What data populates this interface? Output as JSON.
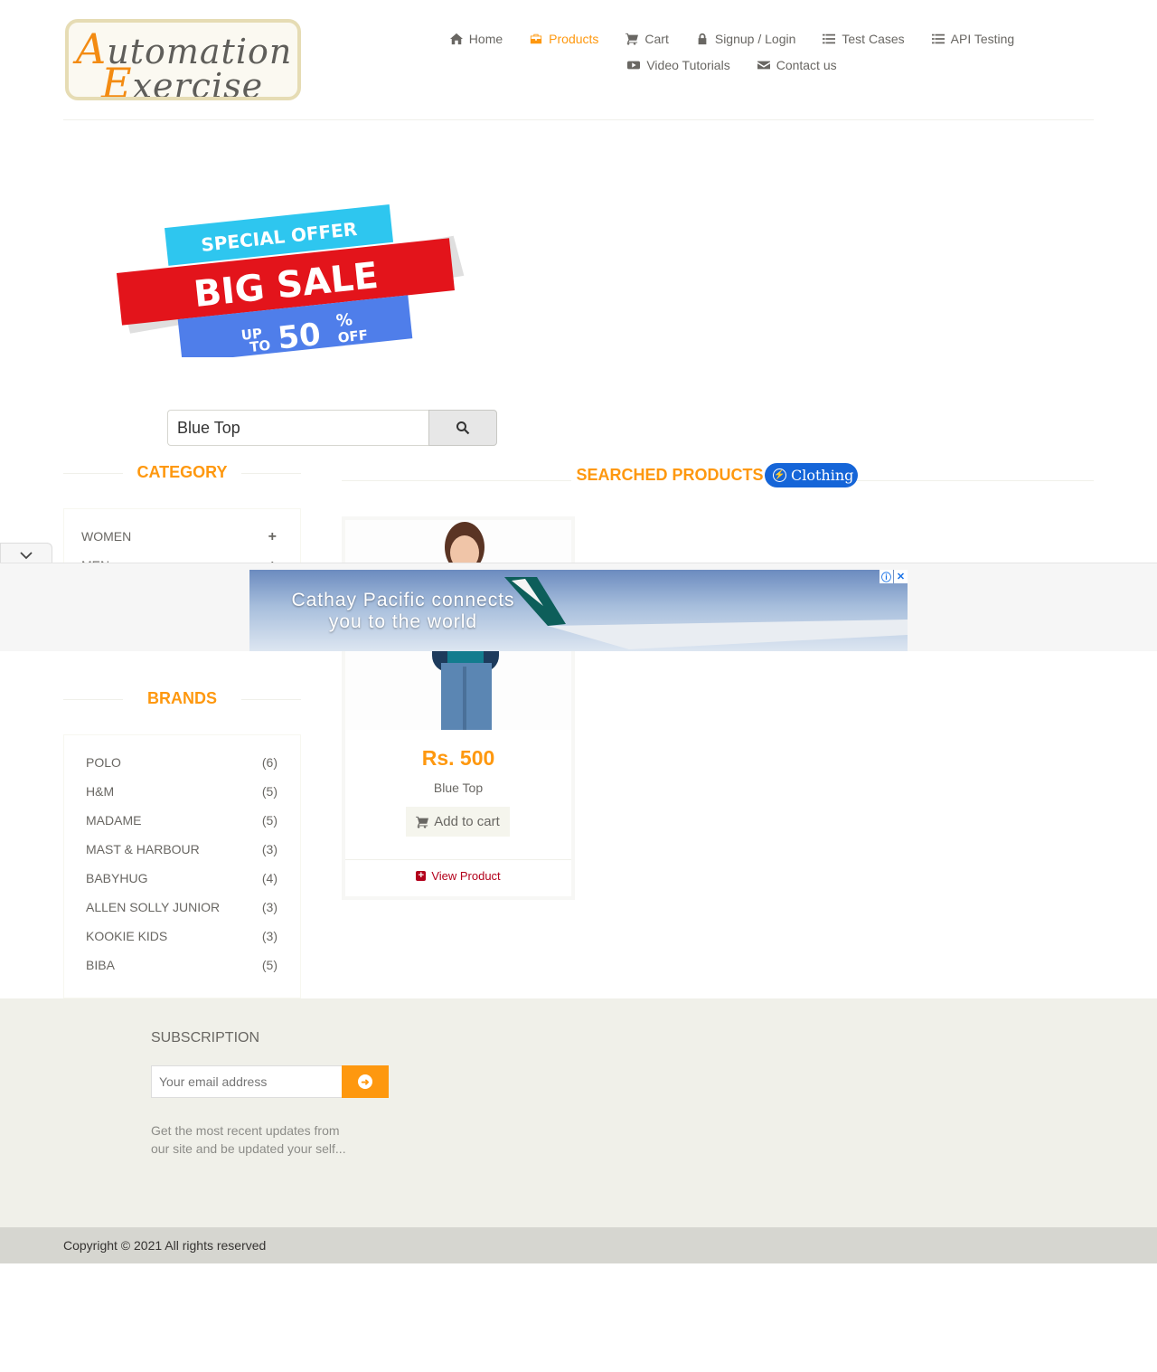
{
  "logo": {
    "line1_first": "A",
    "line1_rest": "utomation",
    "line2_first": "E",
    "line2_rest": "xercise"
  },
  "nav": [
    {
      "label": "Home",
      "icon": "home-icon"
    },
    {
      "label": "Products",
      "icon": "products-icon",
      "active": true
    },
    {
      "label": "Cart",
      "icon": "cart-icon"
    },
    {
      "label": "Signup / Login",
      "icon": "lock-icon"
    },
    {
      "label": "Test Cases",
      "icon": "list-icon"
    },
    {
      "label": "API Testing",
      "icon": "list-icon"
    },
    {
      "label": "Video Tutorials",
      "icon": "youtube-icon"
    },
    {
      "label": "Contact us",
      "icon": "envelope-icon"
    }
  ],
  "banner": {
    "line1": "SPECIAL OFFER",
    "line2": "BIG SALE",
    "up": "UP",
    "to": "TO",
    "value": "50",
    "pct": "%",
    "off": "OFF"
  },
  "search": {
    "value": "Blue Top"
  },
  "category": {
    "title": "CATEGORY",
    "items": [
      {
        "label": "WOMEN"
      },
      {
        "label": "MEN"
      }
    ]
  },
  "brands": {
    "title": "BRANDS",
    "items": [
      {
        "name": "POLO",
        "count": "(6)"
      },
      {
        "name": "H&M",
        "count": "(5)"
      },
      {
        "name": "MADAME",
        "count": "(5)"
      },
      {
        "name": "MAST & HARBOUR",
        "count": "(3)"
      },
      {
        "name": "BABYHUG",
        "count": "(4)"
      },
      {
        "name": "ALLEN SOLLY JUNIOR",
        "count": "(3)"
      },
      {
        "name": "KOOKIE KIDS",
        "count": "(3)"
      },
      {
        "name": "BIBA",
        "count": "(5)"
      }
    ]
  },
  "results": {
    "title": "SEARCHED PRODUCTS",
    "badge": "Clothing",
    "product": {
      "price": "Rs. 500",
      "name": "Blue Top",
      "add_label": "Add to cart",
      "view_label": "View Product"
    }
  },
  "ad": {
    "line1": "Cathay Pacific connects",
    "line2": "you to the world"
  },
  "footer": {
    "subscription_title": "SUBSCRIPTION",
    "email_placeholder": "Your email address",
    "description": "Get the most recent updates from our site and be updated your self...",
    "copyright": "Copyright © 2021 All rights reserved"
  },
  "colors": {
    "accent": "#fe980f",
    "text": "#696763",
    "footer_bg": "#f0f0e9",
    "copyright_bg": "#d6d6d0",
    "badge": "#1565d8"
  }
}
